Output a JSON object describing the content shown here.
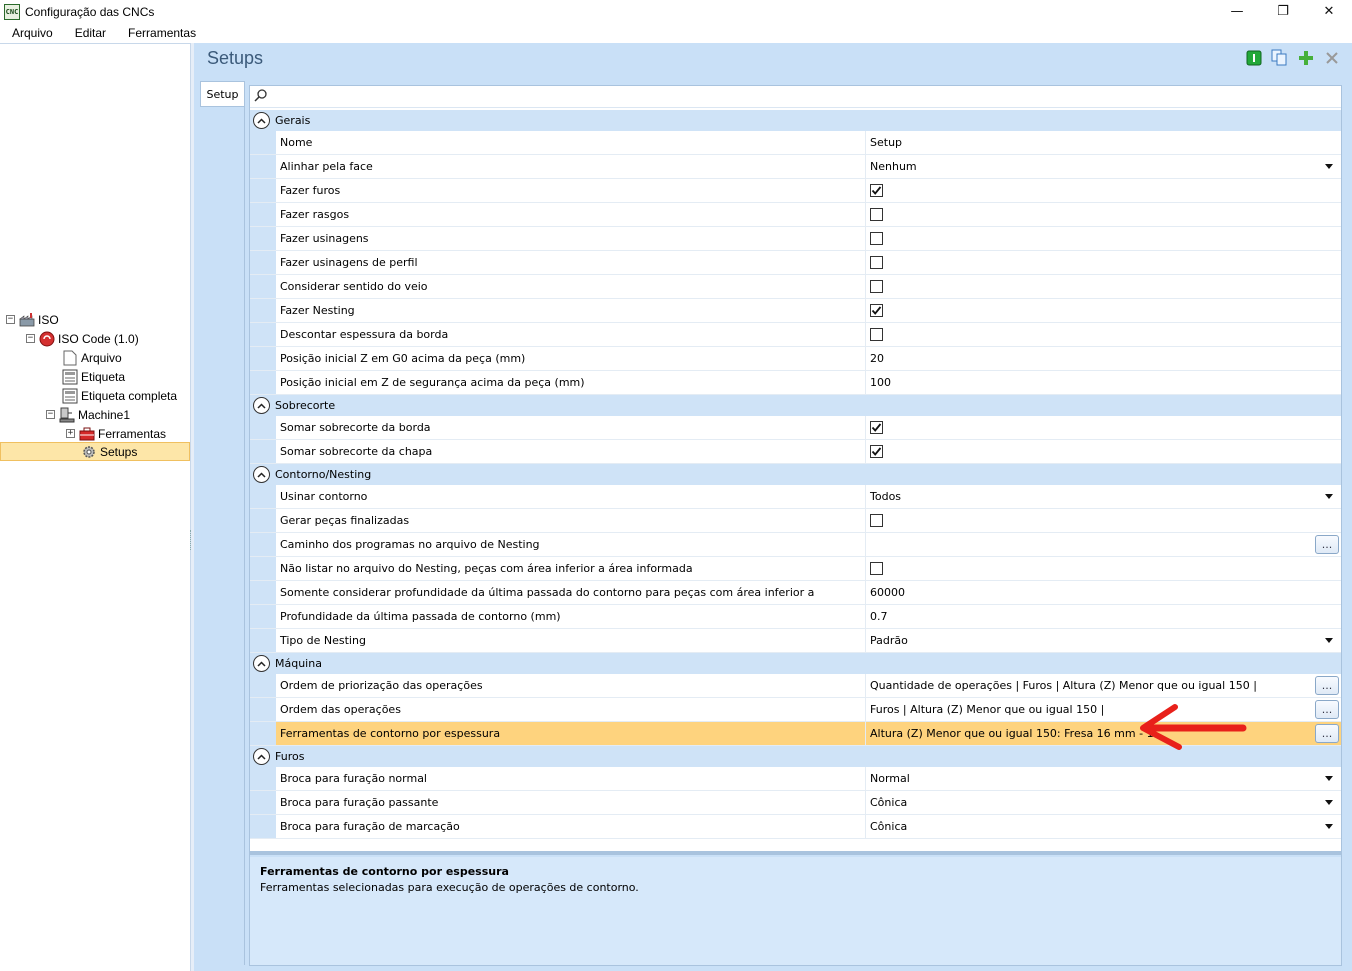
{
  "window": {
    "title": "Configuração das CNCs",
    "app_icon_text": "CNC",
    "minimize": "—",
    "restore": "❐",
    "close": "✕"
  },
  "menu": [
    "Arquivo",
    "Editar",
    "Ferramentas"
  ],
  "tree": {
    "root": "ISO",
    "iso_code": "ISO Code (1.0)",
    "arquivo": "Arquivo",
    "etiqueta": "Etiqueta",
    "etiqueta_completa": "Etiqueta completa",
    "machine": "Machine1",
    "ferramentas": "Ferramentas",
    "setups": "Setups"
  },
  "header": {
    "title": "Setups"
  },
  "tab": {
    "label": "Setup"
  },
  "categories": {
    "gerais": "Gerais",
    "sobrecorte": "Sobrecorte",
    "contorno": "Contorno/Nesting",
    "maquina": "Máquina",
    "furos": "Furos"
  },
  "props": {
    "nome": {
      "name": "Nome",
      "value": "Setup"
    },
    "alinhar": {
      "name": "Alinhar pela face",
      "value": "Nenhum"
    },
    "fazer_furos": {
      "name": "Fazer furos",
      "checked": true
    },
    "fazer_rasgos": {
      "name": "Fazer rasgos",
      "checked": false
    },
    "fazer_usinagens": {
      "name": "Fazer usinagens",
      "checked": false
    },
    "fazer_usinagens_perfil": {
      "name": "Fazer usinagens de perfil",
      "checked": false
    },
    "considerar_veio": {
      "name": "Considerar sentido do veio",
      "checked": false
    },
    "fazer_nesting": {
      "name": "Fazer Nesting",
      "checked": true
    },
    "descontar_borda": {
      "name": "Descontar espessura da borda",
      "checked": false
    },
    "pos_z_g0": {
      "name": "Posição inicial Z em G0 acima da peça (mm)",
      "value": "20"
    },
    "pos_z_seg": {
      "name": "Posição inicial em Z de segurança acima da peça (mm)",
      "value": "100"
    },
    "somar_borda": {
      "name": "Somar sobrecorte da borda",
      "checked": true
    },
    "somar_chapa": {
      "name": "Somar sobrecorte da chapa",
      "checked": true
    },
    "usinar_contorno": {
      "name": "Usinar contorno",
      "value": "Todos"
    },
    "gerar_pecas": {
      "name": "Gerar peças finalizadas",
      "checked": false
    },
    "caminho": {
      "name": "Caminho dos programas no arquivo de Nesting",
      "value": ""
    },
    "nao_listar": {
      "name": "Não listar no arquivo do Nesting, peças com área inferior a área informada",
      "checked": false
    },
    "somente_prof": {
      "name": "Somente considerar profundidade da última passada do contorno para peças com área inferior a",
      "value": "60000"
    },
    "prof_ultima": {
      "name": "Profundidade da última passada de contorno (mm)",
      "value": "0.7"
    },
    "tipo_nesting": {
      "name": "Tipo de Nesting",
      "value": "Padrão"
    },
    "ordem_prior": {
      "name": "Ordem de priorização das operações",
      "value": "Quantidade de operações | Furos | Altura (Z) Menor que ou igual 150 |"
    },
    "ordem_ops": {
      "name": "Ordem das operações",
      "value": "Furos | Altura (Z) Menor que ou igual 150 |"
    },
    "ferr_contorno": {
      "name": "Ferramentas de contorno por espessura",
      "value": "Altura (Z) Menor que ou igual 150: Fresa 16 mm - 1"
    },
    "broca_normal": {
      "name": "Broca para furação normal",
      "value": "Normal"
    },
    "broca_passante": {
      "name": "Broca para furação passante",
      "value": "Cônica"
    },
    "broca_marcacao": {
      "name": "Broca para furação de marcação",
      "value": "Cônica"
    }
  },
  "ellipsis": "...",
  "description": {
    "title": "Ferramentas de contorno por espessura",
    "text": "Ferramentas selecionadas para execução de operações de contorno."
  },
  "colors": {
    "highlight": "#fed37e",
    "panel": "#c9e0f7",
    "arrow": "#e8201a",
    "title": "#3b5a7a"
  }
}
